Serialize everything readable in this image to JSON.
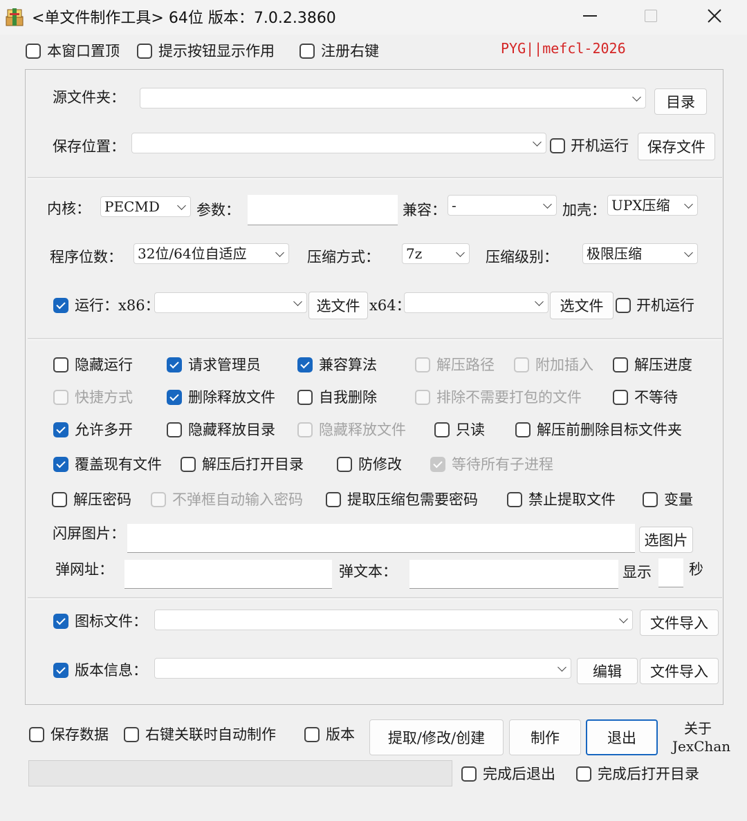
{
  "window": {
    "title": "<单文件制作工具> 64位 版本：7.0.2.3860",
    "watermark": "PYG||mefcl-2026"
  },
  "top_options": {
    "topmost": {
      "label": "本窗口置顶",
      "checked": false
    },
    "tooltip": {
      "label": "提示按钮显示作用",
      "checked": false
    },
    "register": {
      "label": "注册右键",
      "checked": false
    }
  },
  "source": {
    "label": "源文件夹：",
    "value": "",
    "dir_button": "目录"
  },
  "save": {
    "label": "保存位置：",
    "value": "",
    "startup_label": "开机运行",
    "startup_checked": false,
    "save_button": "保存文件"
  },
  "core": {
    "kernel_label": "内核：",
    "kernel_value": "PECMD",
    "params_label": "参数：",
    "params_value": "",
    "compat_label": "兼容：",
    "compat_value": "-",
    "shell_label": "加壳：",
    "shell_value": "UPX压缩",
    "bits_label": "程序位数：",
    "bits_value": "32位/64位自适应",
    "method_label": "压缩方式：",
    "method_value": "7z",
    "level_label": "压缩级别：",
    "level_value": "极限压缩"
  },
  "run": {
    "label": "运行：x86：",
    "checked": true,
    "x86_value": "",
    "select_button": "选文件",
    "x64_label": "x64：",
    "x64_value": "",
    "select_button2": "选文件",
    "startup_label": "开机运行",
    "startup_checked": false
  },
  "options": [
    {
      "label": "隐藏运行",
      "state": "off"
    },
    {
      "label": "请求管理员",
      "state": "on"
    },
    {
      "label": "兼容算法",
      "state": "on"
    },
    {
      "label": "解压路径",
      "state": "disabled"
    },
    {
      "label": "附加插入",
      "state": "disabled"
    },
    {
      "label": "解压进度",
      "state": "off"
    },
    {
      "label": "快捷方式",
      "state": "disabled"
    },
    {
      "label": "删除释放文件",
      "state": "on"
    },
    {
      "label": "自我删除",
      "state": "off"
    },
    {
      "label": "排除不需要打包的文件",
      "state": "disabled"
    },
    {
      "label": "不等待",
      "state": "off"
    },
    {
      "label": "允许多开",
      "state": "on"
    },
    {
      "label": "隐藏释放目录",
      "state": "off"
    },
    {
      "label": "隐藏释放文件",
      "state": "disabled"
    },
    {
      "label": "只读",
      "state": "off"
    },
    {
      "label": "解压前删除目标文件夹",
      "state": "off"
    },
    {
      "label": "覆盖现有文件",
      "state": "on"
    },
    {
      "label": "解压后打开目录",
      "state": "off"
    },
    {
      "label": "防修改",
      "state": "off"
    },
    {
      "label": "等待所有子进程",
      "state": "disabled-on"
    },
    {
      "label": "解压密码",
      "state": "off"
    },
    {
      "label": "不弹框自动输入密码",
      "state": "disabled"
    },
    {
      "label": "提取压缩包需要密码",
      "state": "off"
    },
    {
      "label": "禁止提取文件",
      "state": "off"
    },
    {
      "label": "变量",
      "state": "off"
    }
  ],
  "splash": {
    "label": "闪屏图片：",
    "value": "",
    "button": "选图片"
  },
  "popup": {
    "url_label": "弹网址：",
    "url_value": "",
    "text_label": "弹文本：",
    "text_value": "",
    "show_label": "显示",
    "seconds_value": "",
    "seconds_label": "秒"
  },
  "icon_file": {
    "label": "图标文件：",
    "checked": true,
    "value": "",
    "button": "文件导入"
  },
  "version_info": {
    "label": "版本信息：",
    "checked": true,
    "value": "",
    "edit_button": "编辑",
    "import_button": "文件导入"
  },
  "bottom": {
    "save_data": {
      "label": "保存数据",
      "checked": false
    },
    "auto_make": {
      "label": "右键关联时自动制作",
      "checked": false
    },
    "version": {
      "label": "版本",
      "checked": false
    },
    "extract_button": "提取/修改/创建",
    "make_button": "制作",
    "exit_button": "退出",
    "about_line1": "关于",
    "about_line2": "JexChan",
    "exit_after": {
      "label": "完成后退出",
      "checked": false
    },
    "open_after": {
      "label": "完成后打开目录",
      "checked": false
    },
    "progress": 0
  }
}
